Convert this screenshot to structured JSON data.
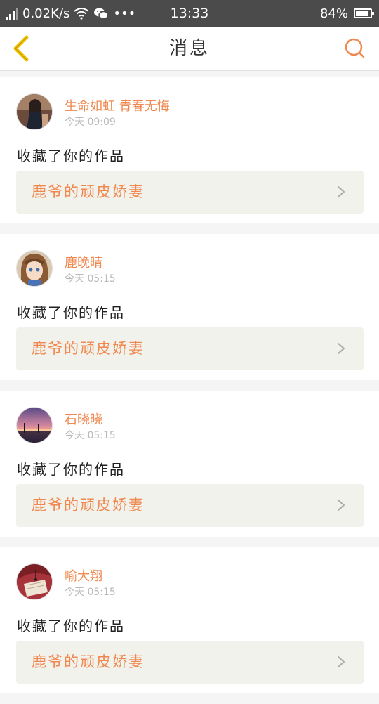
{
  "status_bar": {
    "speed": "0.02K/s",
    "more": "•••",
    "time": "13:33",
    "battery_percent": "84%",
    "battery_level": 0.84
  },
  "nav": {
    "title": "消息",
    "back_icon": "chevron-left-icon",
    "search_icon": "search-icon"
  },
  "colors": {
    "accent": "#f0884f",
    "back_icon": "#f2c300",
    "card_link_bg": "#f2f2ec"
  },
  "messages": [
    {
      "sender": "生命如虹 青春无悔",
      "time": "今天 09:09",
      "action": "收藏了你的作品",
      "work_title": "鹿爷的顽皮娇妻"
    },
    {
      "sender": "鹿晚晴",
      "time": "今天 05:15",
      "action": "收藏了你的作品",
      "work_title": "鹿爷的顽皮娇妻"
    },
    {
      "sender": "石晓晓",
      "time": "今天 05:15",
      "action": "收藏了你的作品",
      "work_title": "鹿爷的顽皮娇妻"
    },
    {
      "sender": "喻大翔",
      "time": "今天 05:15",
      "action": "收藏了你的作品",
      "work_title": "鹿爷的顽皮娇妻"
    }
  ]
}
